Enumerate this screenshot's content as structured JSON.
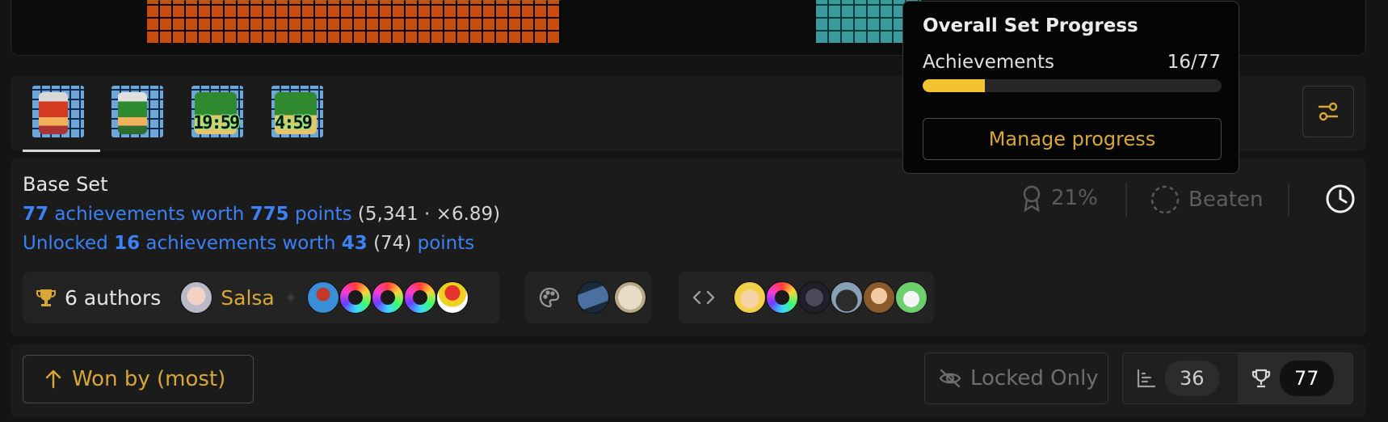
{
  "popover": {
    "title": "Overall Set Progress",
    "progress_label": "Achievements",
    "progress_value": "16/77",
    "progress_fraction": 0.208,
    "manage_label": "Manage progress"
  },
  "tabs": [
    {
      "icon": "mario-sprite-red",
      "timer": ""
    },
    {
      "icon": "mario-sprite-green",
      "timer": ""
    },
    {
      "icon": "bowser-sprite",
      "timer": "19:59"
    },
    {
      "icon": "bowser-sprite",
      "timer": "4:59"
    }
  ],
  "set": {
    "title": "Base Set",
    "total_count": "77",
    "total_text_a": "achievements worth",
    "total_points": "775",
    "total_text_b": "points",
    "total_extra": "(5,341 · ×6.89)",
    "unlocked_prefix": "Unlocked",
    "unlocked_count": "16",
    "unlocked_text_a": "achievements worth",
    "unlocked_points": "43",
    "unlocked_extra": "(74)",
    "unlocked_text_b": "points"
  },
  "stats": {
    "percent": "21%",
    "beaten_label": "Beaten"
  },
  "credits": {
    "authors_label": "6 authors",
    "lead_author": "Salsa"
  },
  "toolbar": {
    "sort_label": "Won by (most)",
    "locked_label": "Locked Only",
    "count_unlocked": "36",
    "count_total": "77"
  },
  "colors": {
    "accent_gold": "#d9a737",
    "link_blue": "#3b82f6",
    "progress_fill": "#f4c430"
  }
}
